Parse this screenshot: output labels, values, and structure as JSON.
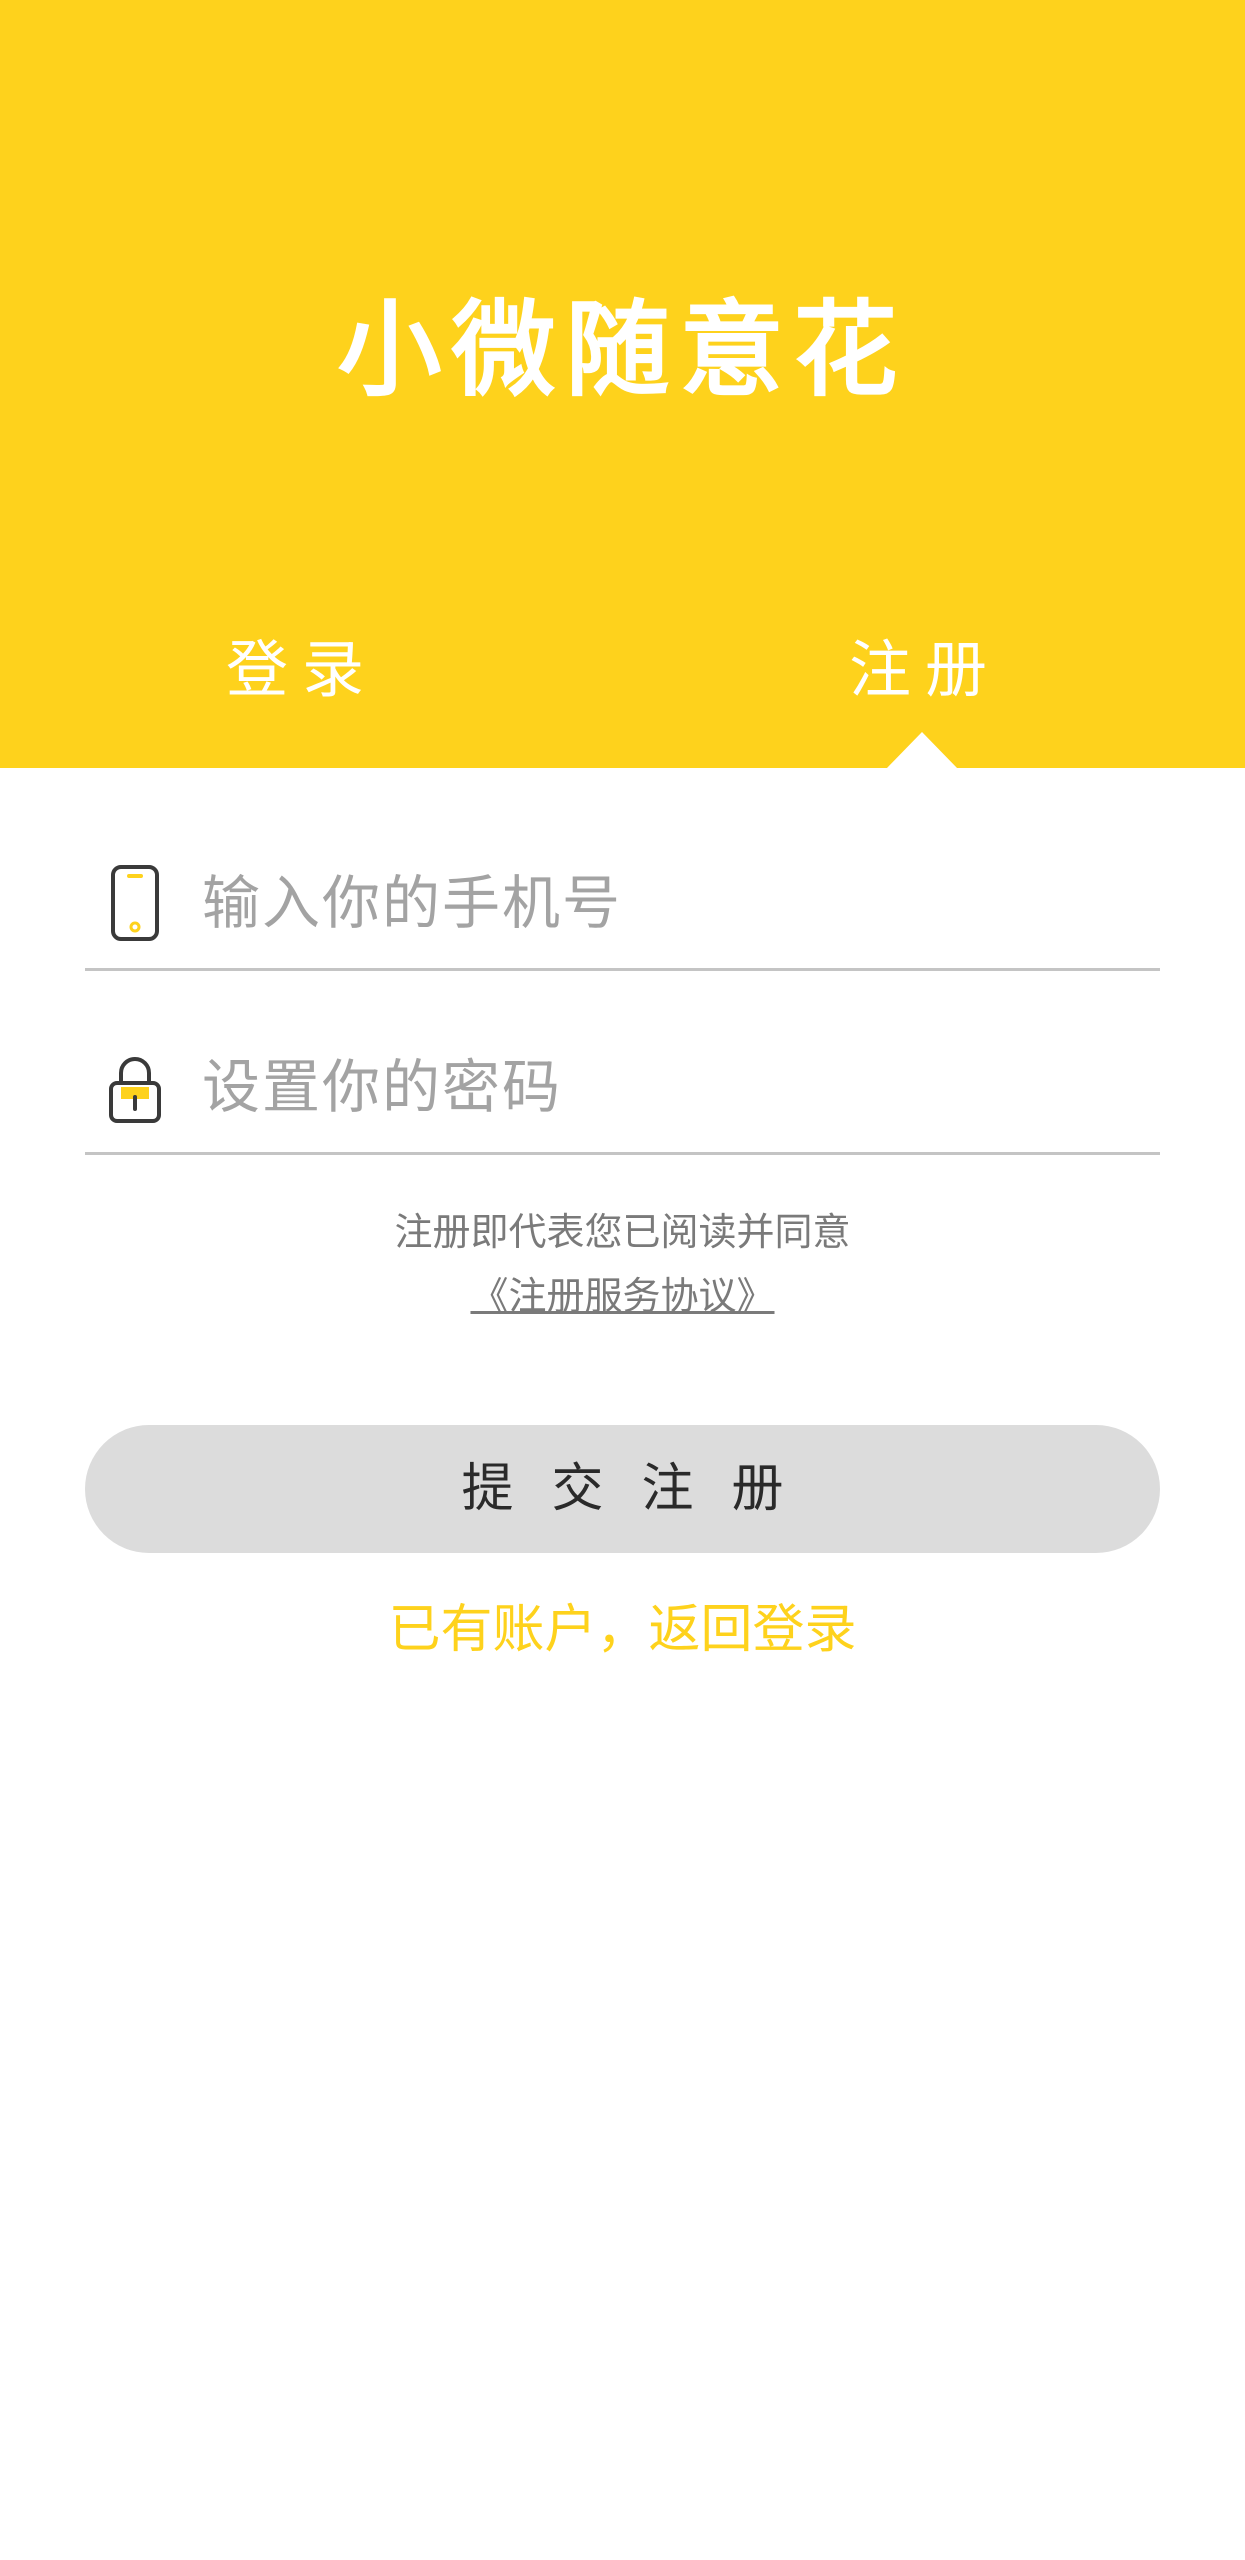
{
  "app": {
    "title": "小微随意花"
  },
  "tabs": [
    {
      "label": "登录",
      "active": false
    },
    {
      "label": "注册",
      "active": true
    }
  ],
  "form": {
    "phone": {
      "placeholder": "输入你的手机号",
      "value": "",
      "icon": "phone-icon"
    },
    "password": {
      "placeholder": "设置你的密码",
      "value": "",
      "icon": "lock-icon"
    }
  },
  "agreement": {
    "text": "注册即代表您已阅读并同意",
    "link_label": "《注册服务协议》"
  },
  "submit": {
    "label": "提交注册"
  },
  "back_link": {
    "label": "已有账户，返回登录"
  },
  "colors": {
    "brand": "#fed21c",
    "button_bg": "#dcdcdc",
    "placeholder": "#a3a3a3",
    "divider": "#c4c4c4"
  }
}
